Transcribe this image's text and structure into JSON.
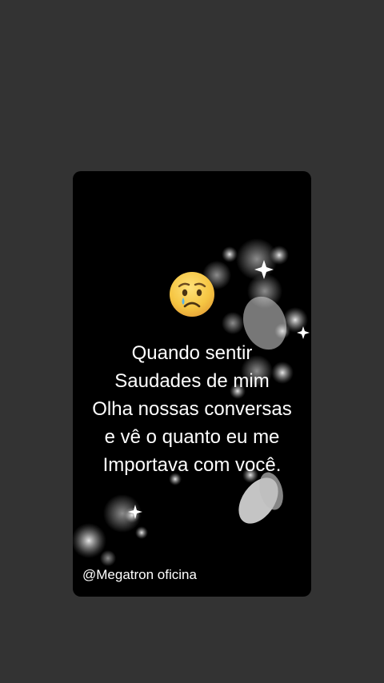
{
  "story": {
    "emoji": "crying-face-icon",
    "quote_lines": [
      "Quando sentir",
      "Saudades de mim",
      "Olha nossas conversas",
      "e vê o quanto eu me",
      "Importava com você."
    ],
    "watermark": "@Megatron oficina"
  },
  "colors": {
    "page_background": "#333333",
    "card_background": "#000000",
    "text": "#ffffff",
    "emoji_face": "#f5c542"
  }
}
